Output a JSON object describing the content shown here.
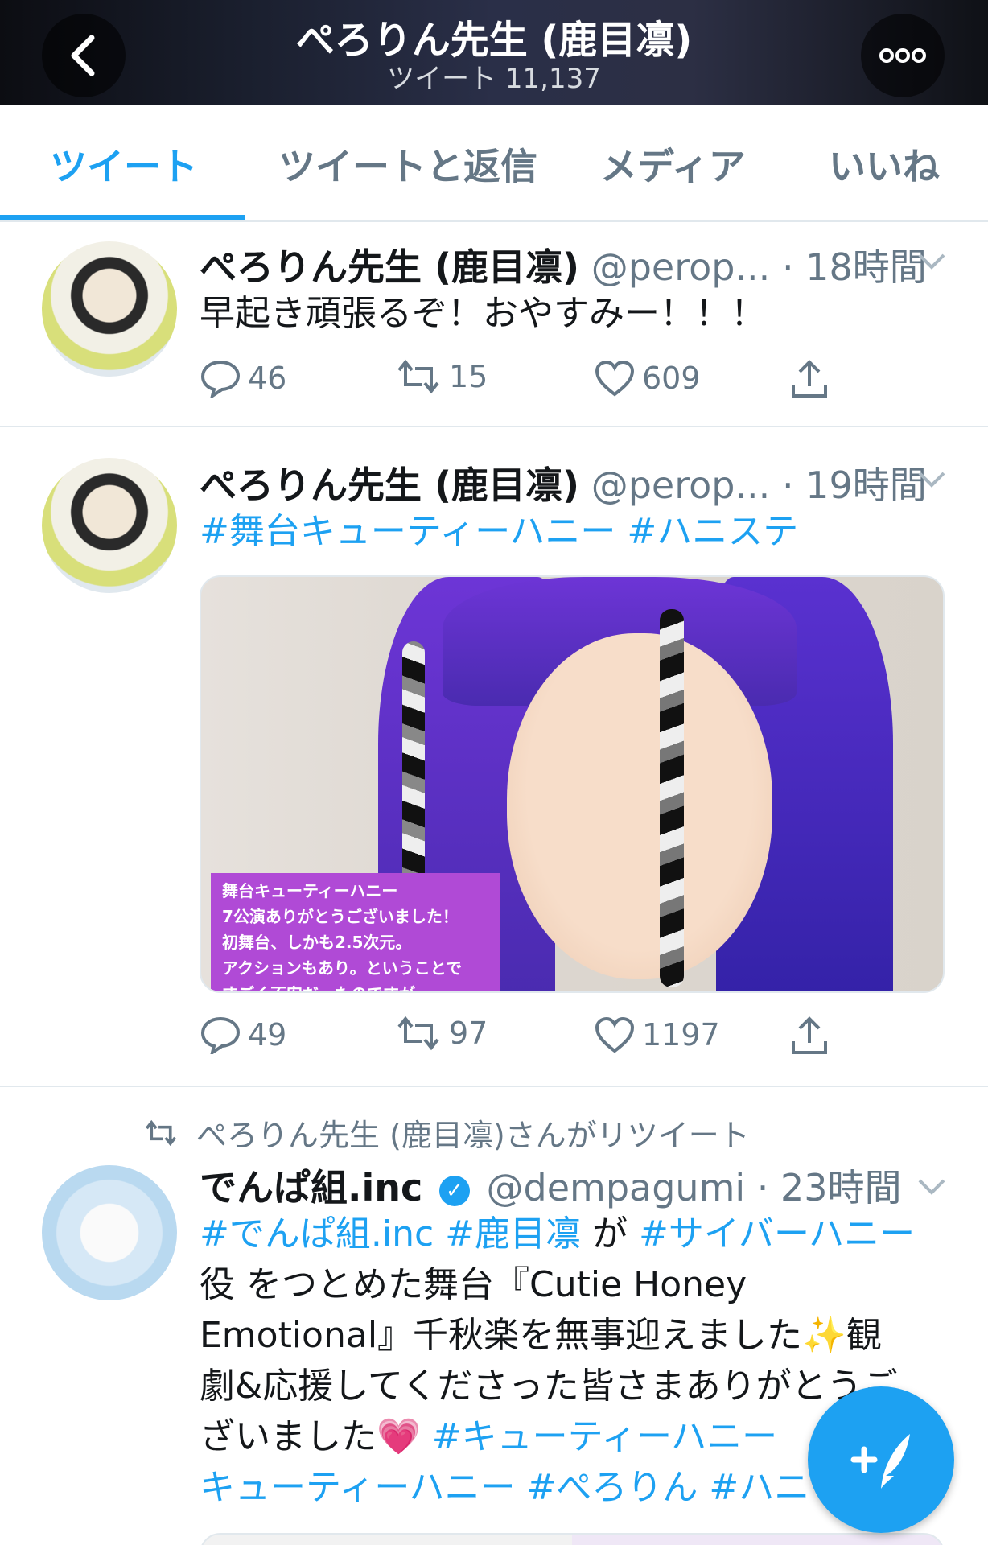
{
  "header": {
    "title": "ぺろりん先生 (鹿目凛)",
    "subtitle": "ツイート 11,137",
    "back_icon": "chevron-left-icon",
    "more_icon": "more-dots-icon"
  },
  "tabs": [
    {
      "label": "ツイート",
      "active": true
    },
    {
      "label": "ツイートと返信"
    },
    {
      "label": "メディア"
    },
    {
      "label": "いいね"
    }
  ],
  "tweets": [
    {
      "name": "ぺろりん先生 (鹿目凛)",
      "handle": "@perop...",
      "time": "· 18時間",
      "text": "早起き頑張るぞ！おやすみー！！！",
      "replies": "46",
      "retweets": "15",
      "likes": "609"
    },
    {
      "name": "ぺろりん先生 (鹿目凛)",
      "handle": "@perop...",
      "time": "· 19時間",
      "hashtags": [
        "#舞台キューティーハニー",
        "#ハニステ"
      ],
      "media_caption": [
        "舞台キューティーハニー",
        "7公演ありがとうございました！",
        "初舞台、しかも2.5次元。",
        "アクションもあり。ということで",
        "すごく不安だったのですが"
      ],
      "replies": "49",
      "retweets": "97",
      "likes": "1197"
    },
    {
      "retweet_by": "ぺろりん先生 (鹿目凛)さんがリツイート",
      "name": "でんぱ組.inc",
      "handle": "@dempagumi",
      "time": "· 23時間",
      "line1": [
        "#でんぱ組.inc",
        " ",
        "#鹿目凛",
        " が ",
        "#サイバーハニー"
      ],
      "line2": "役 をつとめた舞台『Cutie Honey",
      "line3": "Emotional』千秋楽を無事迎えました✨観",
      "line4": "劇&応援してくださった皆さまありがとうご",
      "line5_text": "ざいました💗 ",
      "line5_hash": "#キューティーハニー",
      "line6": [
        "キューティーハニー",
        " ",
        "#ぺろりん",
        " ",
        "#ハニ"
      ]
    }
  ],
  "fab": {
    "icon": "compose-tweet-icon",
    "label": "+"
  }
}
